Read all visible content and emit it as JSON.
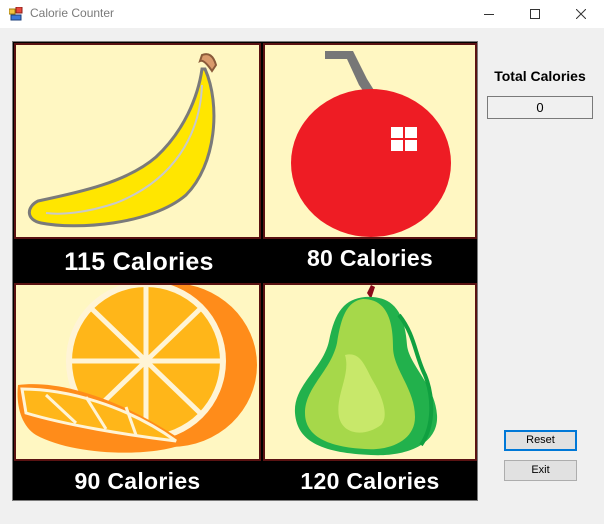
{
  "window": {
    "title": "Calorie Counter"
  },
  "title_bar": {
    "buttons": [
      "minimize-icon",
      "maximize-icon",
      "close-icon"
    ]
  },
  "fruits": [
    {
      "name": "banana",
      "caption": "115 Calories"
    },
    {
      "name": "apple",
      "caption": "80 Calories"
    },
    {
      "name": "orange",
      "caption": "90 Calories"
    },
    {
      "name": "pear",
      "caption": "120 Calories"
    }
  ],
  "total": {
    "label": "Total Calories",
    "value": "0"
  },
  "buttons": {
    "reset": "Reset",
    "exit": "Exit"
  },
  "colors": {
    "tile_background": "#fff7c2",
    "caption_background": "#000000",
    "caption_text": "#ffffff",
    "banana": "#ffe600",
    "apple": "#ee1c24",
    "orange": "#ffb619",
    "pear": "#a6d84a"
  }
}
